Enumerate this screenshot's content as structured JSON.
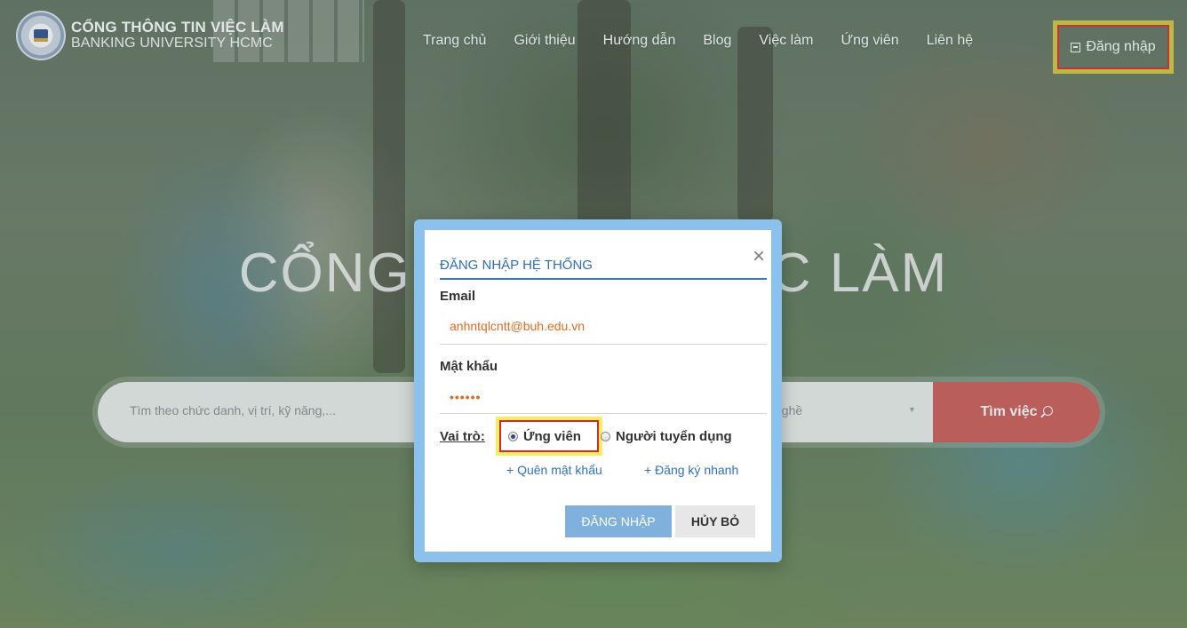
{
  "header": {
    "logo_title": "CỔNG THÔNG TIN VIỆC LÀM",
    "logo_subtitle": "BANKING UNIVERSITY HCMC",
    "nav": [
      "Trang chủ",
      "Giới thiệu",
      "Hướng dẫn",
      "Blog",
      "Việc làm",
      "Ứng viên",
      "Liên hệ"
    ],
    "login_label": "Đăng nhập"
  },
  "hero": {
    "title_left": "CỔNG",
    "title_right": "C LÀM"
  },
  "search": {
    "placeholder": "Tìm theo chức danh, vị trí, kỹ năng,...",
    "select_value": "nghề",
    "button_label": "Tìm việc"
  },
  "login_modal": {
    "title": "ĐĂNG NHẬP HỆ THỐNG",
    "close_symbol": "×",
    "email_label": "Email",
    "email_value": "anhntqlcntt@buh.edu.vn",
    "password_label": "Mật khẩu",
    "password_mask": "••••••",
    "role_label": "Vai trò:",
    "role_options": [
      "Ứng viên",
      "Người tuyển dụng"
    ],
    "selected_role": "Ứng viên",
    "forgot_link": "+ Quên mật khẩu",
    "register_link": "+ Đăng ký nhanh",
    "login_button": "ĐĂNG NHẬP",
    "cancel_button": "HỦY BỎ"
  },
  "colors": {
    "accent_blue": "#2f7dbf",
    "modal_frame": "#8cc1ec",
    "search_button": "#cf5b56",
    "input_text": "#e06b20",
    "highlight_red": "#d9272a",
    "highlight_yellow": "#f6e630"
  }
}
